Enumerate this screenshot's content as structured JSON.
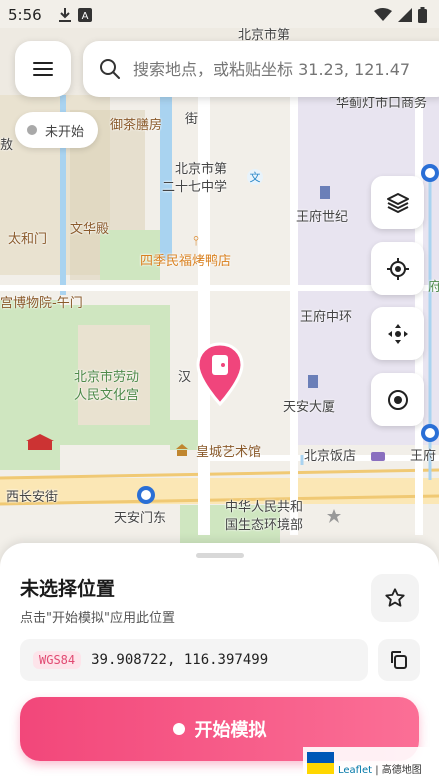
{
  "status_bar": {
    "time": "5:56",
    "left_icons": [
      "download-icon",
      "font-app-icon"
    ],
    "right_icons": [
      "wifi-icon",
      "signal-icon",
      "battery-icon"
    ]
  },
  "search": {
    "placeholder": "搜索地点，或粘贴坐标 31.23, 121.47"
  },
  "status_chip": {
    "label": "未开始",
    "dot_color": "#a9a9a9"
  },
  "map": {
    "labels": {
      "beijing_city_top": "北京市第",
      "huajiang": "华蓟灯市口商务",
      "yucha": "御茶膳房",
      "jie": "街",
      "school_1": "北京市第",
      "school_2": "二十七中学",
      "wangfu_world": "王府世纪",
      "wenhua": "文华殿",
      "taihe": "太和门",
      "siji": "四季民福烤鸭店",
      "museum": "宫博物院-午门",
      "wangfu_middle": "王府中环",
      "culture_palace_1": "北京市劳动",
      "culture_palace_2": "人民文化宫",
      "han": "汉",
      "tianan_tower": "天安大厦",
      "huangcheng": "皇城艺术馆",
      "beijing_hotel": "北京饭店",
      "wangfu_right": "王府",
      "xichang": "西长安街",
      "tiananmen_east": "天安门东",
      "ministry_1": "中华人民共和",
      "ministry_2": "国生态环境部",
      "ao": "敖",
      "fu": "府"
    },
    "pin_color": "#f0457c"
  },
  "controls": [
    "layers-icon",
    "locate-icon",
    "move-icon",
    "target-icon"
  ],
  "sheet": {
    "title": "未选择位置",
    "subtitle": "点击\"开始模拟\"应用此位置",
    "coord_badge": "WGS84",
    "coords": "39.908722, 116.397499",
    "start_label": "开始模拟"
  },
  "attribution": {
    "leaflet": "Leaflet",
    "separator": " | ",
    "provider": "高德地图"
  },
  "colors": {
    "accent": "#f2477a",
    "accent_light": "#fb6f96",
    "map_bg": "#f2efe9",
    "park": "#cfe6c0",
    "water": "#a9d3f0",
    "gov_area": "#e8e4f0"
  }
}
